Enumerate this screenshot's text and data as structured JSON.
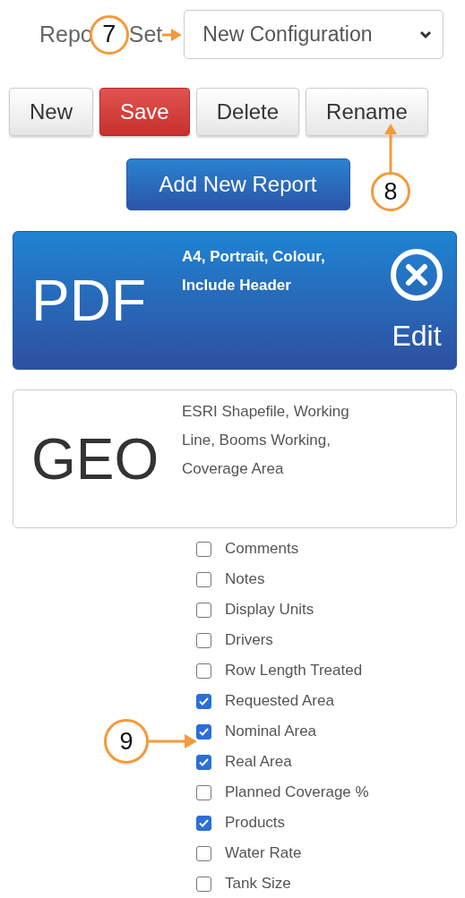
{
  "report_set": {
    "label_parts": [
      "Repo",
      "Set"
    ],
    "value": "New Configuration"
  },
  "buttons": [
    {
      "label": "New",
      "kind": "default"
    },
    {
      "label": "Save",
      "kind": "danger"
    },
    {
      "label": "Delete",
      "kind": "default"
    },
    {
      "label": "Rename",
      "kind": "default"
    }
  ],
  "add_button": {
    "label": "Add New Report"
  },
  "reports": [
    {
      "format": "PDF",
      "description": "A4, Portrait, Colour, Include Header",
      "selected": true,
      "action": "Edit"
    },
    {
      "format": "GEO",
      "description": "ESRI Shapefile, Working Line, Booms Working, Coverage Area",
      "selected": false
    }
  ],
  "options": [
    {
      "label": "Comments",
      "checked": false
    },
    {
      "label": "Notes",
      "checked": false
    },
    {
      "label": "Display Units",
      "checked": false
    },
    {
      "label": "Drivers",
      "checked": false
    },
    {
      "label": "Row Length Treated",
      "checked": false
    },
    {
      "label": "Requested Area",
      "checked": true
    },
    {
      "label": "Nominal Area",
      "checked": true
    },
    {
      "label": "Real Area",
      "checked": true
    },
    {
      "label": "Planned Coverage %",
      "checked": false
    },
    {
      "label": "Products",
      "checked": true
    },
    {
      "label": "Water Rate",
      "checked": false
    },
    {
      "label": "Tank Size",
      "checked": false
    }
  ],
  "callouts": [
    "7",
    "8",
    "9"
  ]
}
